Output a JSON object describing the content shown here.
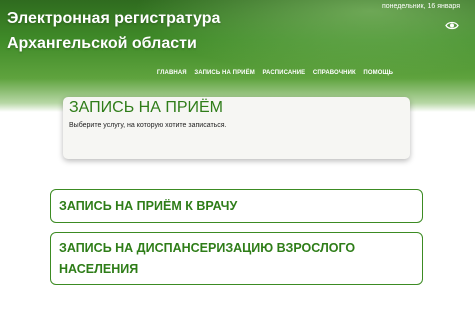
{
  "header": {
    "title_line1": "Электронная регистратура",
    "title_line2": "Архангельской области",
    "date": "понедельник, 16 января",
    "accessibility_icon": "eye-icon"
  },
  "nav": {
    "items": [
      {
        "label": "ГЛАВНАЯ"
      },
      {
        "label": "ЗАПИСЬ НА ПРИЁМ"
      },
      {
        "label": "РАСПИСАНИЕ"
      },
      {
        "label": "СПРАВОЧНИК"
      },
      {
        "label": "ПОМОЩЬ"
      }
    ]
  },
  "card": {
    "title": "ЗАПИСЬ НА ПРИЁМ",
    "text": "Выберите услугу, на которую хотите записаться."
  },
  "services": [
    {
      "label": "ЗАПИСЬ НА ПРИЁМ К ВРАЧУ"
    },
    {
      "label": "ЗАПИСЬ НА ДИСПАНСЕРИЗАЦИЮ ВЗРОСЛОГО НАСЕЛЕНИЯ"
    }
  ],
  "colors": {
    "header_green": "#3f8a28",
    "accent_green": "#2f7d19"
  }
}
